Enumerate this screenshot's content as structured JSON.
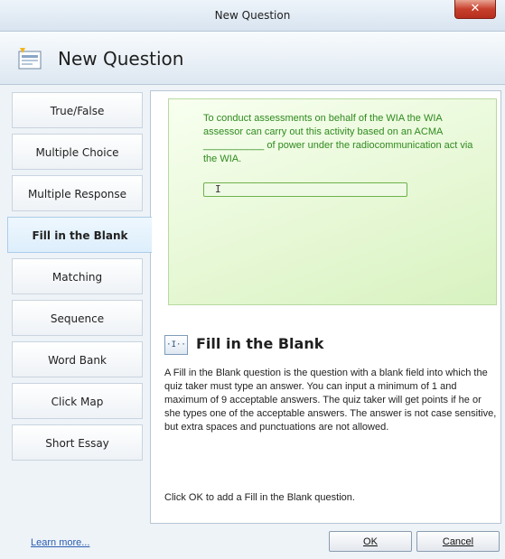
{
  "window": {
    "title": "New Question",
    "close_glyph": "✕"
  },
  "header": {
    "title": "New Question",
    "icon": "new-question-icon"
  },
  "question_types": [
    {
      "label": "True/False"
    },
    {
      "label": "Multiple Choice"
    },
    {
      "label": "Multiple Response"
    },
    {
      "label": "Fill in the Blank",
      "selected": true
    },
    {
      "label": "Matching"
    },
    {
      "label": "Sequence"
    },
    {
      "label": "Word Bank"
    },
    {
      "label": "Click Map"
    },
    {
      "label": "Short Essay"
    }
  ],
  "preview": {
    "question_text": "To conduct assessments on behalf of the WIA the WIA assessor can carry out this activity based on an ACMA ___________ of power under the radiocommunication act via the WIA.",
    "answer_value": "I"
  },
  "description": {
    "icon": "fill-blank-icon",
    "icon_glyph": "·I··",
    "title": "Fill in the Blank",
    "body": "A Fill in the Blank question is the question with a blank field into which the quiz taker must type an answer. You can input a minimum of 1 and maximum of 9 acceptable answers.  The quiz taker will get points if he or she types one of the acceptable answers. The answer is not case sensitive, but extra spaces and punctuations are not allowed.",
    "footer": "Click OK to add a Fill in the Blank question."
  },
  "footer": {
    "learn_more": "Learn more...",
    "ok_label": "OK",
    "cancel_label": "Cancel"
  },
  "colors": {
    "accent_green": "#2f8a1f",
    "link_blue": "#2a5db0"
  }
}
